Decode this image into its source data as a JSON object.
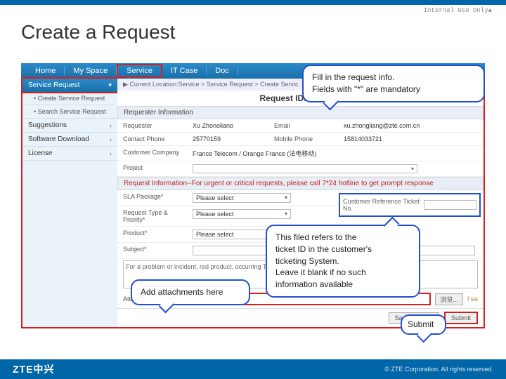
{
  "classification": "Internal Use Only▲",
  "page_title": "Create a Request",
  "nav": {
    "items": [
      "Home",
      "My Space",
      "Service",
      "IT Case",
      "Doc"
    ]
  },
  "sidebar": {
    "active": "Service Request",
    "sub": "• Create Service Request",
    "items": [
      "• Search Service Request",
      "Suggestions",
      "Software Download",
      "License"
    ]
  },
  "breadcrumb": "▶ Current Location:Service > Service Request > Create Servic",
  "request_id_label": "Request ID:RU201…",
  "section1": "Requester Information",
  "fields": {
    "requester_label": "Requester",
    "requester_value": "Xu Zhonoliano",
    "email_label": "Email",
    "email_value": "xu.zhongliang@zte.com.cn",
    "contact_label": "Contact Phone",
    "contact_value": "25770159",
    "mobile_label": "Mobile Phone",
    "mobile_value": "15814033721",
    "company_label": "Customer Company",
    "company_value": "France Telecom / Orange France",
    "company_note": "(法电移动)",
    "project_label": "Project"
  },
  "section2": "Request Information--For urgent or critical requests, please call 7*24 hotline to get prompt response",
  "req_fields": {
    "sla_label": "SLA Package*",
    "sla_value": "Please select",
    "type_label": "Request Type & Priority*",
    "type_value": "Please select",
    "product_label": "Product*",
    "product_value": "Please select",
    "subject_label": "Subject*",
    "ticket_label1": "Customer Reference Ticket No.",
    "desc_placeholder": "For a problem or incident,\nred product, occurring T…"
  },
  "attachment": {
    "label": "Attachment",
    "browse": "浏览...",
    "note_suffix": "f ea"
  },
  "buttons": {
    "save_draft": "Save as Draft",
    "submit": "Submit"
  },
  "callouts": {
    "c1a": "Fill in the request info.",
    "c1b": "Fields with \"*\" are mandatory",
    "c2a": "This filed refers to the",
    "c2b": "ticket ID in the customer's",
    "c2c": "ticketing System.",
    "c2d": "Leave it blank if no such",
    "c2e": "information available",
    "c3": "Add attachments here",
    "c4": "Submit"
  },
  "footer": {
    "logo": "ZTE中兴",
    "copy": "© ZTE Corporation. All rights reserved."
  }
}
